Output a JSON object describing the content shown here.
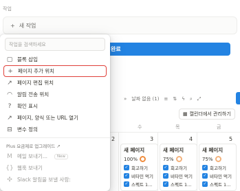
{
  "background": {
    "section_label": "작업",
    "new_action_label": "새 작업",
    "done_label": "완료",
    "toolbar": {
      "date_filter": "날짜 없음 (1)"
    },
    "manage_calendar_label": "캘린더에서 관리하기",
    "day_headers": [
      "수",
      "목",
      "금"
    ],
    "day_numbers": [
      "2",
      "3",
      "4",
      "5"
    ],
    "cards": [
      {
        "title": "새 페이지",
        "percent": "100%",
        "checks": [
          "회고하기",
          "비타민 먹기",
          "스펙트 1..."
        ]
      },
      {
        "title": "새 페이지",
        "percent": "75%",
        "checks": [
          "회고하기",
          "비타민 먹기",
          "스펙트 1..."
        ]
      },
      {
        "title": "새 페이지",
        "percent": "75%",
        "checks": [
          "회고하기",
          "비타민 먹기",
          "스펙트 1..."
        ]
      }
    ],
    "left_card_checks": [
      "스펙트 1..."
    ]
  },
  "menu": {
    "search_placeholder": "작업을 검색하세요",
    "items": [
      {
        "label": "블록 삽입",
        "icon": "block-icon"
      },
      {
        "label": "페이지 추가 위치",
        "icon": "plus-icon",
        "highlighted": true
      },
      {
        "label": "페이지 편집 위치",
        "icon": "arrow-up-right-icon"
      },
      {
        "label": "알림 전송 위치",
        "icon": "bell-icon"
      },
      {
        "label": "확인 표시",
        "icon": "question-circle-icon"
      },
      {
        "label": "페이지, 양식 또는 URL 열기",
        "icon": "arrow-up-right-icon"
      },
      {
        "label": "변수 정의",
        "icon": "variable-icon"
      }
    ],
    "plus_upgrade_label": "Plus 요금제로 업그레이드 ↗",
    "plus_items": [
      {
        "label": "메일 보내기...",
        "badge": "New",
        "icon": "mail-icon"
      },
      {
        "label": "웹훅 보내기",
        "icon": "webhook-icon"
      },
      {
        "label": "Slack 알림을 보낼 사람:",
        "icon": "slack-icon"
      }
    ]
  }
}
